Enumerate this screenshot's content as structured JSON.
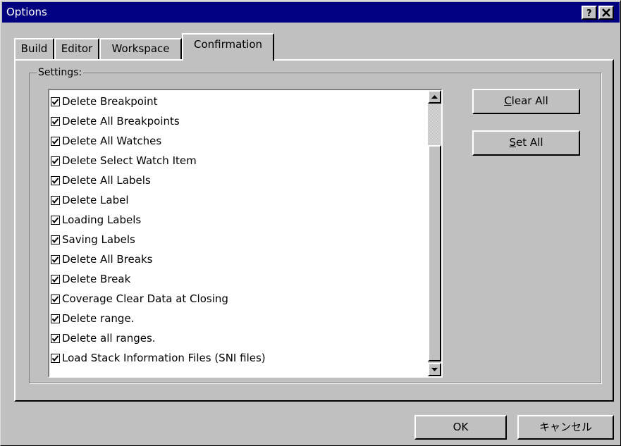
{
  "window": {
    "title": "Options",
    "help_glyph": "?",
    "close_glyph": "✕"
  },
  "tabs": [
    {
      "label": "Build",
      "active": false
    },
    {
      "label": "Editor",
      "active": false
    },
    {
      "label": "Workspace",
      "active": false
    },
    {
      "label": "Confirmation",
      "active": true
    }
  ],
  "settings": {
    "group_label": "Settings:",
    "items": [
      {
        "label": "Delete Breakpoint",
        "checked": true
      },
      {
        "label": "Delete All Breakpoints",
        "checked": true
      },
      {
        "label": "Delete All Watches",
        "checked": true
      },
      {
        "label": "Delete Select Watch Item",
        "checked": true
      },
      {
        "label": "Delete All Labels",
        "checked": true
      },
      {
        "label": "Delete Label",
        "checked": true
      },
      {
        "label": "Loading Labels",
        "checked": true
      },
      {
        "label": "Saving Labels",
        "checked": true
      },
      {
        "label": "Delete All Breaks",
        "checked": true
      },
      {
        "label": "Delete Break",
        "checked": true
      },
      {
        "label": "Coverage Clear Data at Closing",
        "checked": true
      },
      {
        "label": "Delete range.",
        "checked": true
      },
      {
        "label": "Delete all ranges.",
        "checked": true
      },
      {
        "label": "Load Stack Information Files (SNI files)",
        "checked": true
      }
    ],
    "clear_all": {
      "mnemonic": "C",
      "rest": "lear All"
    },
    "set_all": {
      "mnemonic": "S",
      "rest": "et All"
    }
  },
  "footer": {
    "ok_label": "OK",
    "cancel_label": "キャンセル"
  }
}
